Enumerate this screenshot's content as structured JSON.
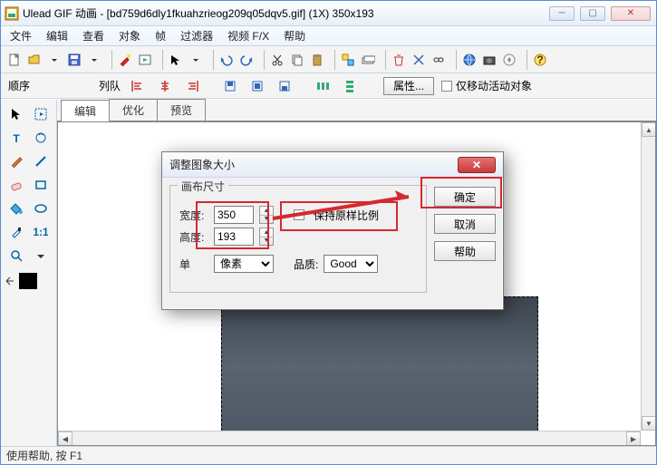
{
  "title": "Ulead GIF 动画 - [bd759d6dly1fkuahzrieog209q05dqv5.gif] (1X) 350x193",
  "menu": {
    "file": "文件",
    "edit": "编辑",
    "view": "查看",
    "object": "对象",
    "frame": "帧",
    "filter": "过滤器",
    "videofx": "视频 F/X",
    "help": "帮助"
  },
  "toolbar2": {
    "order": "顺序",
    "queue": "列队",
    "props": "属性...",
    "move_only": "仅移动活动对象"
  },
  "tabs": {
    "edit": "编辑",
    "optimize": "优化",
    "preview": "预览"
  },
  "dialog": {
    "title": "调整图象大小",
    "fs_title": "画布尺寸",
    "width_label": "宽度:",
    "width_value": "350",
    "height_label": "高度:",
    "height_value": "193",
    "keep_ratio": "保持原样比例",
    "unit_label": "单",
    "unit_value": "像素",
    "quality_label": "品质:",
    "quality_value": "Good",
    "ok": "确定",
    "cancel": "取消",
    "help": "帮助"
  },
  "status": "使用帮助, 按 F1"
}
